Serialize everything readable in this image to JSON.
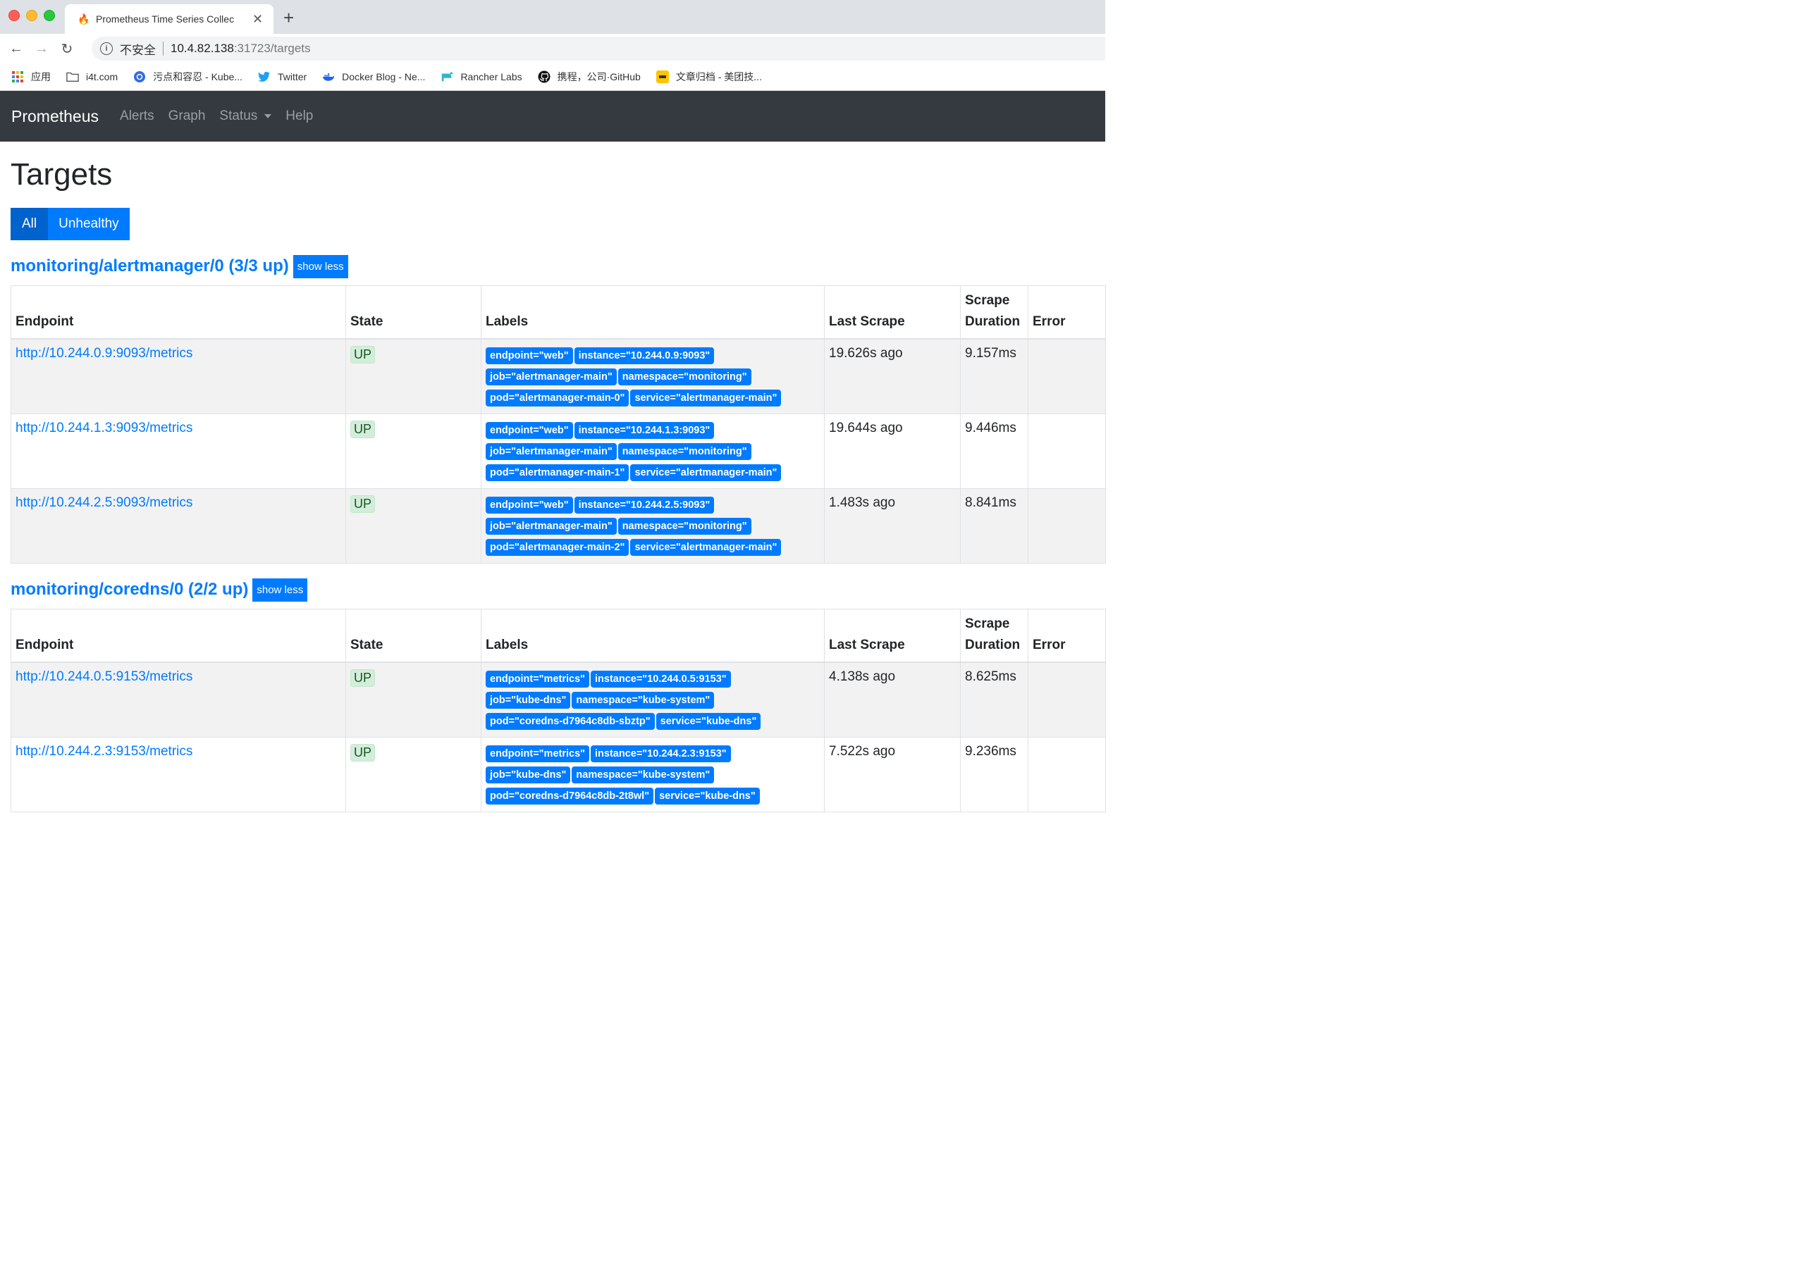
{
  "browser": {
    "tab_title": "Prometheus Time Series Collec",
    "url_insecure": "不安全",
    "url_host": "10.4.82.138",
    "url_path": ":31723/targets",
    "bookmarks": [
      {
        "label": "应用",
        "icon": "apps-grid-icon"
      },
      {
        "label": "i4t.com",
        "icon": "folder-icon"
      },
      {
        "label": "污点和容忍 - Kube...",
        "icon": "kubernetes-icon"
      },
      {
        "label": "Twitter",
        "icon": "twitter-icon"
      },
      {
        "label": "Docker Blog - Ne...",
        "icon": "docker-icon"
      },
      {
        "label": "Rancher Labs",
        "icon": "rancher-icon"
      },
      {
        "label": "携程，公司·GitHub",
        "icon": "github-icon"
      },
      {
        "label": "文章归档 - 美团技...",
        "icon": "meituan-icon"
      }
    ]
  },
  "navbar": {
    "brand": "Prometheus",
    "links": [
      "Alerts",
      "Graph",
      "Status",
      "Help"
    ]
  },
  "page": {
    "title": "Targets",
    "filter_all": "All",
    "filter_unhealthy": "Unhealthy",
    "show_less": "show less",
    "headers": {
      "endpoint": "Endpoint",
      "state": "State",
      "labels": "Labels",
      "last_scrape": "Last Scrape",
      "scrape_duration_1": "Scrape",
      "scrape_duration_2": "Duration",
      "error": "Error"
    }
  },
  "groups": [
    {
      "title": "monitoring/alertmanager/0 (3/3 up)",
      "rows": [
        {
          "endpoint": "http://10.244.0.9:9093/metrics",
          "state": "UP",
          "labels": [
            [
              "endpoint=\"web\"",
              "instance=\"10.244.0.9:9093\""
            ],
            [
              "job=\"alertmanager-main\"",
              "namespace=\"monitoring\""
            ],
            [
              "pod=\"alertmanager-main-0\"",
              "service=\"alertmanager-main\""
            ]
          ],
          "last_scrape": "19.626s ago",
          "duration": "9.157ms",
          "error": ""
        },
        {
          "endpoint": "http://10.244.1.3:9093/metrics",
          "state": "UP",
          "labels": [
            [
              "endpoint=\"web\"",
              "instance=\"10.244.1.3:9093\""
            ],
            [
              "job=\"alertmanager-main\"",
              "namespace=\"monitoring\""
            ],
            [
              "pod=\"alertmanager-main-1\"",
              "service=\"alertmanager-main\""
            ]
          ],
          "last_scrape": "19.644s ago",
          "duration": "9.446ms",
          "error": ""
        },
        {
          "endpoint": "http://10.244.2.5:9093/metrics",
          "state": "UP",
          "labels": [
            [
              "endpoint=\"web\"",
              "instance=\"10.244.2.5:9093\""
            ],
            [
              "job=\"alertmanager-main\"",
              "namespace=\"monitoring\""
            ],
            [
              "pod=\"alertmanager-main-2\"",
              "service=\"alertmanager-main\""
            ]
          ],
          "last_scrape": "1.483s ago",
          "duration": "8.841ms",
          "error": ""
        }
      ]
    },
    {
      "title": "monitoring/coredns/0 (2/2 up)",
      "rows": [
        {
          "endpoint": "http://10.244.0.5:9153/metrics",
          "state": "UP",
          "labels": [
            [
              "endpoint=\"metrics\"",
              "instance=\"10.244.0.5:9153\""
            ],
            [
              "job=\"kube-dns\"",
              "namespace=\"kube-system\""
            ],
            [
              "pod=\"coredns-d7964c8db-sbztp\"",
              "service=\"kube-dns\""
            ]
          ],
          "last_scrape": "4.138s ago",
          "duration": "8.625ms",
          "error": ""
        },
        {
          "endpoint": "http://10.244.2.3:9153/metrics",
          "state": "UP",
          "labels": [
            [
              "endpoint=\"metrics\"",
              "instance=\"10.244.2.3:9153\""
            ],
            [
              "job=\"kube-dns\"",
              "namespace=\"kube-system\""
            ],
            [
              "pod=\"coredns-d7964c8db-2t8wl\"",
              "service=\"kube-dns\""
            ]
          ],
          "last_scrape": "7.522s ago",
          "duration": "9.236ms",
          "error": ""
        }
      ]
    }
  ]
}
